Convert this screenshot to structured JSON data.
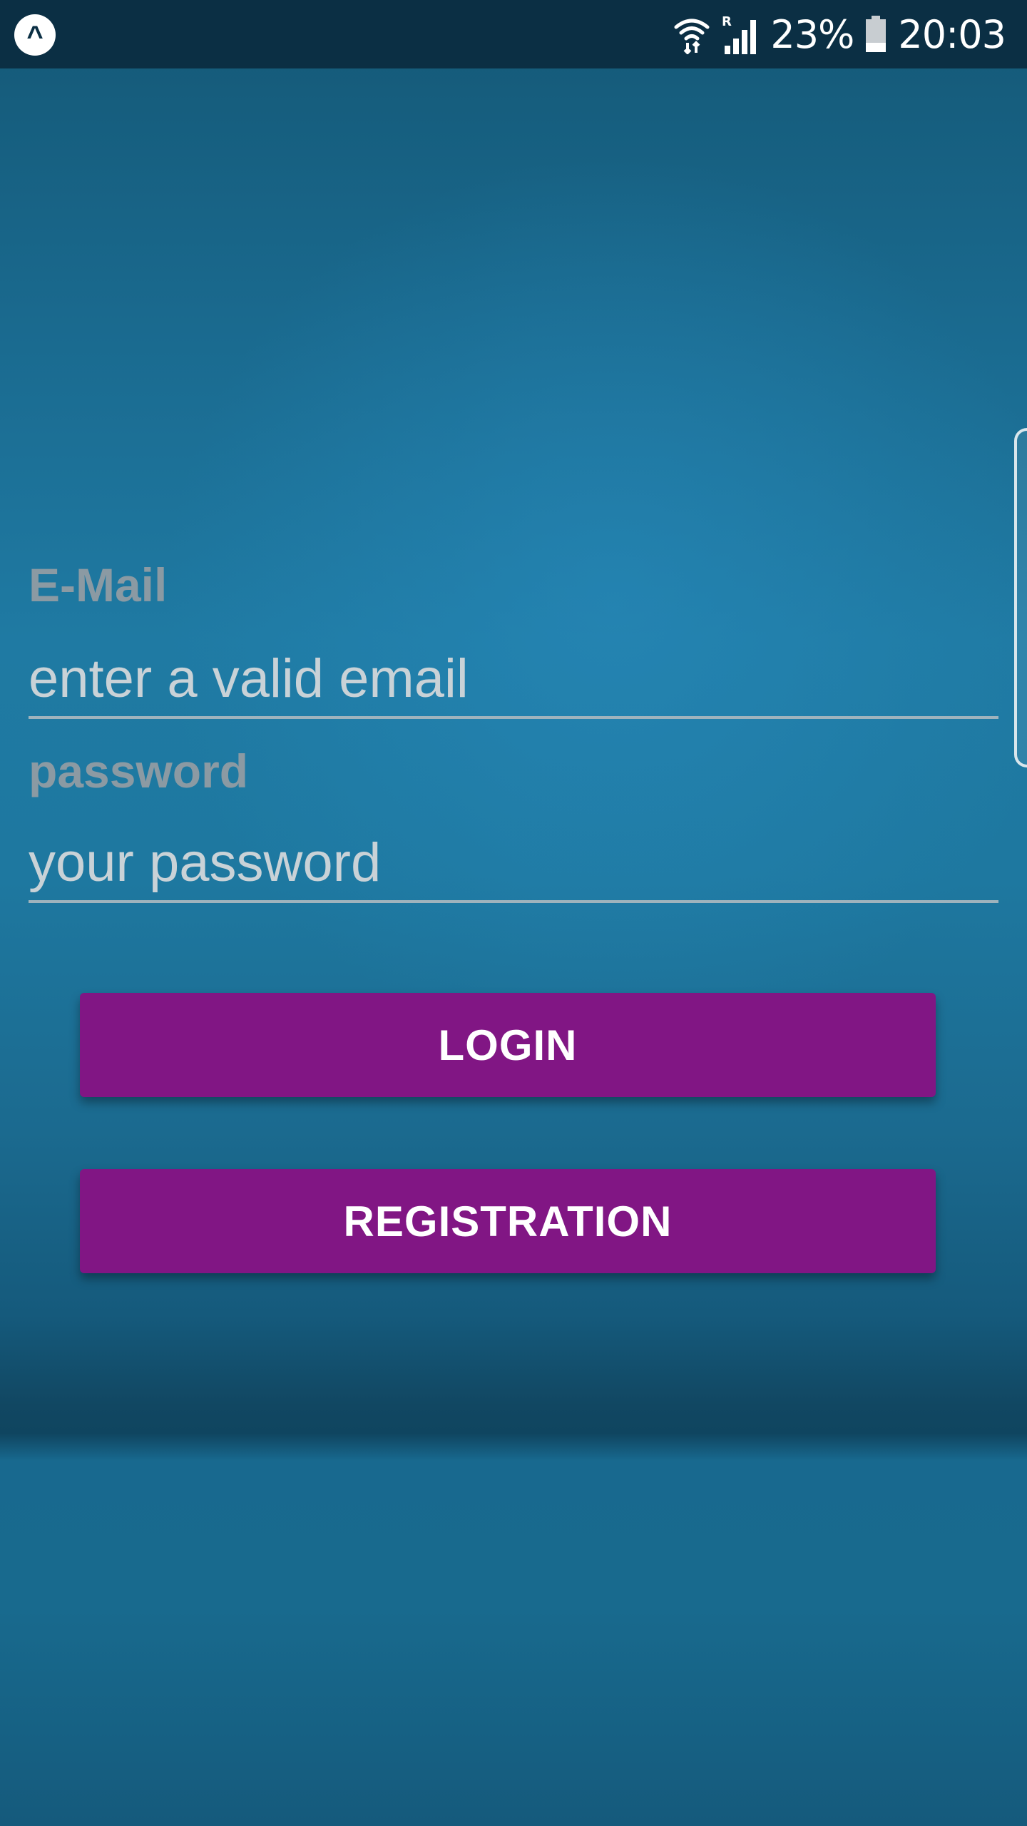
{
  "status_bar": {
    "app_icon": "caret-up-icon",
    "battery_percent": "23%",
    "time": "20:03",
    "icons": [
      "wifi-icon",
      "signal-icon",
      "battery-icon"
    ]
  },
  "form": {
    "email": {
      "label": "E-Mail",
      "placeholder": "enter a valid email",
      "value": ""
    },
    "password": {
      "label": "password",
      "placeholder": "your password",
      "value": ""
    }
  },
  "buttons": {
    "login_label": "LOGIN",
    "registration_label": "REGISTRATION"
  },
  "colors": {
    "background": "#1e78a0",
    "status_bar": "#0b2f44",
    "button": "#811684",
    "label": "#8b9aa3"
  }
}
